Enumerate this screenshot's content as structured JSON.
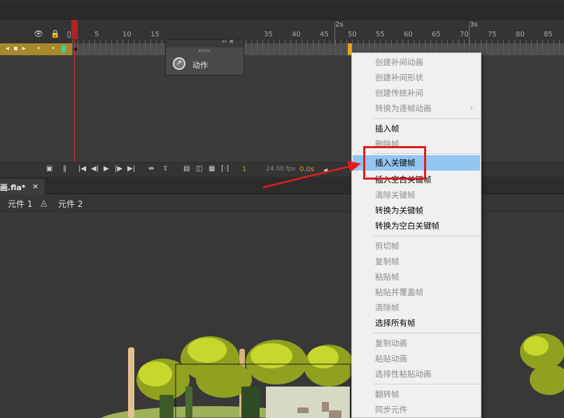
{
  "timeline": {
    "ruler_numbers": [
      "1",
      "5",
      "10",
      "15",
      "35",
      "40",
      "45",
      "50",
      "55",
      "60",
      "65",
      "70",
      "75",
      "80",
      "85"
    ],
    "seconds": [
      "2s",
      "3s"
    ]
  },
  "actions_panel": {
    "label": "动作",
    "header_glyphs": "›› ×"
  },
  "controls": {
    "current_frame": "1",
    "fps": "24.00 fps",
    "time": "0.0s"
  },
  "document_tab": {
    "name": "画.fla*",
    "close": "×"
  },
  "breadcrumb": {
    "scene": "元件 1",
    "symbol": "元件 2"
  },
  "context_menu": {
    "items": [
      {
        "label": "创建补间动画",
        "enabled": false
      },
      {
        "label": "创建补间形状",
        "enabled": false
      },
      {
        "label": "创建传统补间",
        "enabled": false
      },
      {
        "label": "转换为逐帧动画",
        "enabled": false,
        "submenu": true
      },
      {
        "label": "插入帧",
        "enabled": true
      },
      {
        "label": "删除帧",
        "enabled": false
      },
      {
        "label": "插入关键帧",
        "enabled": true,
        "highlighted": true
      },
      {
        "label": "插入空白关键帧",
        "enabled": true
      },
      {
        "label": "清除关键帧",
        "enabled": false
      },
      {
        "label": "转换为关键帧",
        "enabled": true
      },
      {
        "label": "转换为空白关键帧",
        "enabled": true
      },
      {
        "label": "剪切帧",
        "enabled": false
      },
      {
        "label": "复制帧",
        "enabled": false
      },
      {
        "label": "粘贴帧",
        "enabled": false
      },
      {
        "label": "粘贴并覆盖帧",
        "enabled": false
      },
      {
        "label": "清除帧",
        "enabled": false
      },
      {
        "label": "选择所有帧",
        "enabled": true
      },
      {
        "label": "复制动画",
        "enabled": false
      },
      {
        "label": "粘贴动画",
        "enabled": false
      },
      {
        "label": "选择性粘贴动画",
        "enabled": false
      },
      {
        "label": "翻转帧",
        "enabled": false
      },
      {
        "label": "同步元件",
        "enabled": false
      }
    ]
  },
  "colors": {
    "highlight": "#93c5f2",
    "annotation": "#e21c1c",
    "layer": "#a68a2a",
    "selected_frame": "#e5a21a"
  },
  "icons": [
    "eye-icon",
    "lock-icon",
    "outline-icon",
    "actions-icon",
    "play-icon",
    "close-icon",
    "symbol-icon"
  ]
}
